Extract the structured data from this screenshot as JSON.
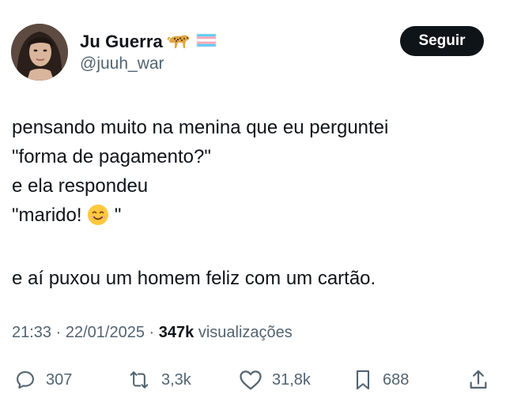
{
  "author": {
    "name": "Ju Guerra",
    "handle": "@juuh_war",
    "badges": [
      "leopard-emoji",
      "transgender-flag-emoji"
    ]
  },
  "follow_button": {
    "label": "Seguir"
  },
  "tweet": {
    "lines": [
      "pensando muito na menina que eu perguntei",
      "\"forma de pagamento?\"",
      "e ela respondeu",
      "\"marido! ",
      " \"",
      "e aí puxou um homem feliz com um cartão."
    ],
    "emoji": "smiling-face-emoji"
  },
  "meta": {
    "time": "21:33",
    "date": "22/01/2025",
    "views_count": "347k",
    "views_label": "visualizações",
    "separator": "·"
  },
  "actions": {
    "replies": "307",
    "reposts": "3,3k",
    "likes": "31,8k",
    "bookmarks": "688"
  },
  "icons": {
    "reply": "reply-icon",
    "repost": "repost-icon",
    "like": "heart-icon",
    "bookmark": "bookmark-icon",
    "share": "share-icon"
  },
  "colors": {
    "text": "#0f1419",
    "secondary": "#536471",
    "button_bg": "#0f1419",
    "button_text": "#ffffff"
  }
}
